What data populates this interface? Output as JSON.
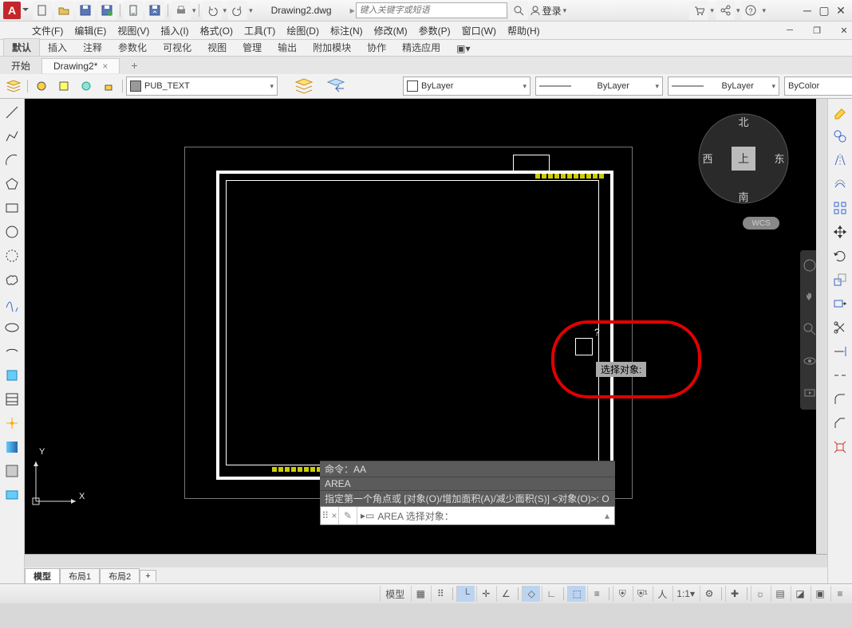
{
  "title_doc": "Drawing2.dwg",
  "search_placeholder": "键入关键字或短语",
  "login_label": "登录",
  "menu": [
    "文件(F)",
    "编辑(E)",
    "视图(V)",
    "插入(I)",
    "格式(O)",
    "工具(T)",
    "绘图(D)",
    "标注(N)",
    "修改(M)",
    "参数(P)",
    "窗口(W)",
    "帮助(H)"
  ],
  "ribbon_tabs": [
    "默认",
    "插入",
    "注释",
    "参数化",
    "可视化",
    "视图",
    "管理",
    "输出",
    "附加模块",
    "协作",
    "精选应用"
  ],
  "file_tabs": {
    "start": "开始",
    "active": "Drawing2*"
  },
  "layer_name": "PUB_TEXT",
  "prop_color": "ByLayer",
  "prop_line": "ByLayer",
  "prop_lw": "ByLayer",
  "prop_plot": "ByColor",
  "viewcube": {
    "top": "上",
    "n": "北",
    "s": "南",
    "e": "东",
    "w": "西"
  },
  "wcs": "WCS",
  "tooltip": "选择对象:",
  "qmark": "?",
  "ucs": {
    "x": "X",
    "y": "Y"
  },
  "cmd_hist": [
    "命令：AA",
    "AREA",
    "指定第一个角点或 [对象(O)/增加面积(A)/减少面积(S)] <对象(O)>: O"
  ],
  "cmd_prompt": "AREA 选择对象：",
  "layout_tabs": [
    "模型",
    "布局1",
    "布局2"
  ],
  "status_scale": "1:1",
  "status_model": "模型"
}
